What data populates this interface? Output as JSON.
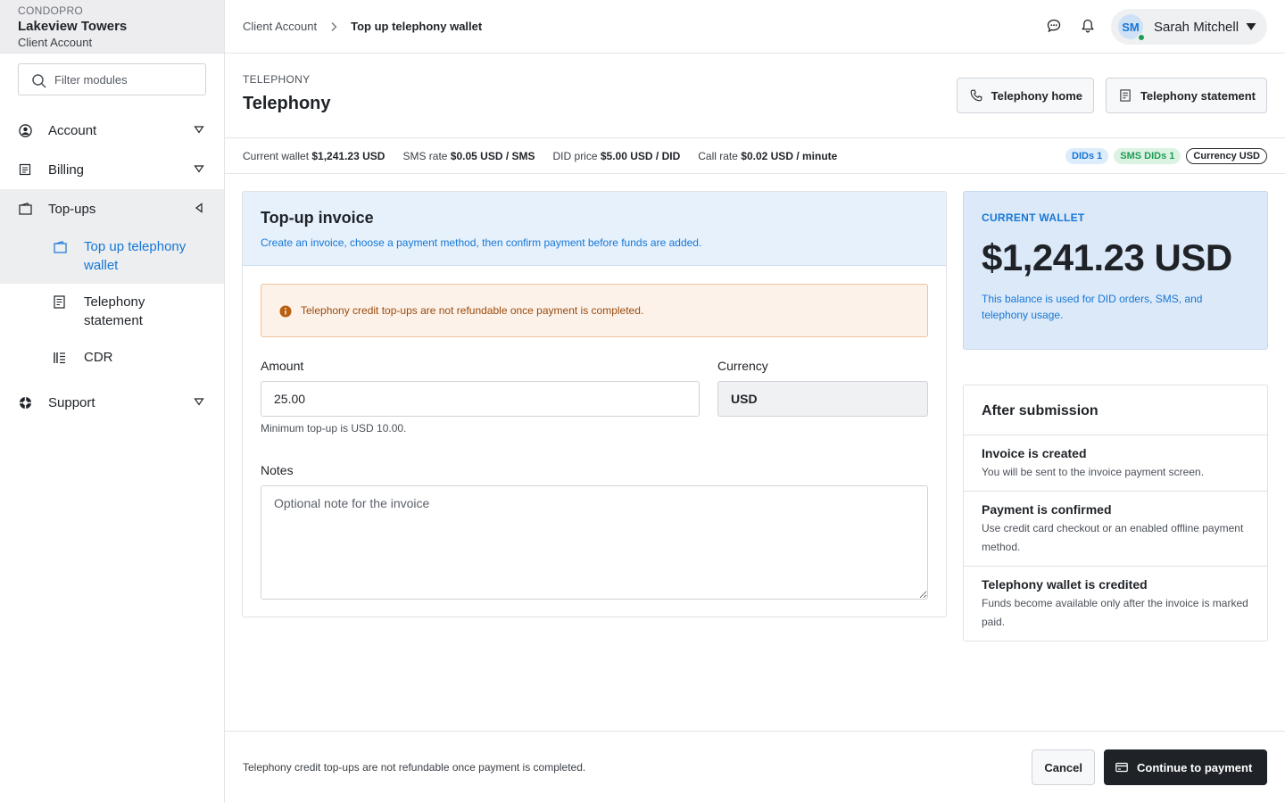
{
  "org": {
    "brand": "CONDOPRO",
    "name": "Lakeview Towers",
    "account": "Client Account"
  },
  "sidebar": {
    "filter_placeholder": "Filter modules",
    "items": [
      {
        "label": "Account",
        "icon": "user-circle-icon"
      },
      {
        "label": "Billing",
        "icon": "receipt-icon"
      },
      {
        "label": "Top-ups",
        "icon": "wallet-icon"
      },
      {
        "label": "Support",
        "icon": "lifebuoy-icon"
      }
    ],
    "subitems": [
      {
        "label": "Top up telephony wallet",
        "icon": "wallet-icon"
      },
      {
        "label": "Telephony statement",
        "icon": "document-icon"
      },
      {
        "label": "CDR",
        "icon": "list-icon"
      }
    ]
  },
  "breadcrumb": {
    "parent": "Client Account",
    "current": "Top up telephony wallet"
  },
  "user": {
    "initials": "SM",
    "name": "Sarah Mitchell"
  },
  "header": {
    "eyebrow": "TELEPHONY",
    "title": "Telephony",
    "home_button": "Telephony home",
    "statement_button": "Telephony statement"
  },
  "stats": {
    "wallet_label": "Current wallet",
    "wallet_value": "$1,241.23 USD",
    "sms_label": "SMS rate",
    "sms_value": "$0.05 USD / SMS",
    "did_label": "DID price",
    "did_value": "$5.00 USD / DID",
    "call_label": "Call rate",
    "call_value": "$0.02 USD / minute",
    "badges": [
      "DIDs 1",
      "SMS DIDs 1",
      "Currency USD"
    ]
  },
  "invoice": {
    "title": "Top-up invoice",
    "subtitle": "Create an invoice, choose a payment method, then confirm payment before funds are added.",
    "alert": "Telephony credit top-ups are not refundable once payment is completed.",
    "amount_label": "Amount",
    "amount_value": "25.00",
    "amount_hint": "Minimum top-up is USD 10.00.",
    "currency_label": "Currency",
    "currency_value": "USD",
    "notes_label": "Notes",
    "notes_placeholder": "Optional note for the invoice"
  },
  "wallet": {
    "caption": "CURRENT WALLET",
    "amount": "$1,241.23 USD",
    "description": "This balance is used for DID orders, SMS, and telephony usage."
  },
  "after": {
    "title": "After submission",
    "steps": [
      {
        "title": "Invoice is created",
        "desc": "You will be sent to the invoice payment screen."
      },
      {
        "title": "Payment is confirmed",
        "desc": "Use credit card checkout or an enabled offline payment method."
      },
      {
        "title": "Telephony wallet is credited",
        "desc": "Funds become available only after the invoice is marked paid."
      }
    ]
  },
  "footer": {
    "note": "Telephony credit top-ups are not refundable once payment is completed.",
    "cancel": "Cancel",
    "continue": "Continue to payment"
  },
  "colors": {
    "accent": "#1677d6",
    "dark": "#1f2328",
    "success": "#1f9d55",
    "warning": "#9a4a0b"
  }
}
